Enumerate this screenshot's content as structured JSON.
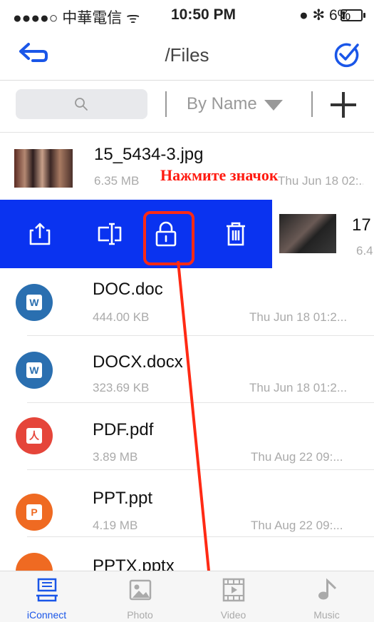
{
  "status_bar": {
    "carrier": "●●●●○ 中華電信 ᯤ",
    "time": "10:50 PM",
    "right": "● ✻ 6%"
  },
  "nav": {
    "title": "/Files"
  },
  "toolbar": {
    "sort_label": "By Name"
  },
  "annotation": {
    "text": "Нажмите значок"
  },
  "files": [
    {
      "name": "15_5434-3.jpg",
      "size": "6.35 MB",
      "date": "Thu Jun 18 02:..."
    },
    {
      "name": "17",
      "size": "6.4"
    },
    {
      "name": "DOC.doc",
      "size": "444.00 KB",
      "date": "Thu Jun 18 01:2...",
      "icon_color": "#2a6fb0",
      "badge": "W"
    },
    {
      "name": "DOCX.docx",
      "size": "323.69 KB",
      "date": "Thu Jun 18 01:2...",
      "icon_color": "#2a6fb0",
      "badge": "W"
    },
    {
      "name": "PDF.pdf",
      "size": "3.89 MB",
      "date": "Thu Aug 22 09:...",
      "icon_color": "#e5453a",
      "badge": "人"
    },
    {
      "name": "PPT.ppt",
      "size": "4.19 MB",
      "date": "Thu Aug 22 09:...",
      "icon_color": "#ef6a22",
      "badge": "P"
    },
    {
      "name": "PPTX.pptx"
    }
  ],
  "tabs": [
    {
      "label": "iConnect",
      "icon": "iconnect-icon",
      "active": true
    },
    {
      "label": "Photo",
      "icon": "photo-icon"
    },
    {
      "label": "Video",
      "icon": "video-icon"
    },
    {
      "label": "Music",
      "icon": "music-icon"
    }
  ],
  "colors": {
    "accent": "#1a56e8",
    "swipe_bg": "#0a33f0",
    "highlight": "#ff2a14"
  }
}
